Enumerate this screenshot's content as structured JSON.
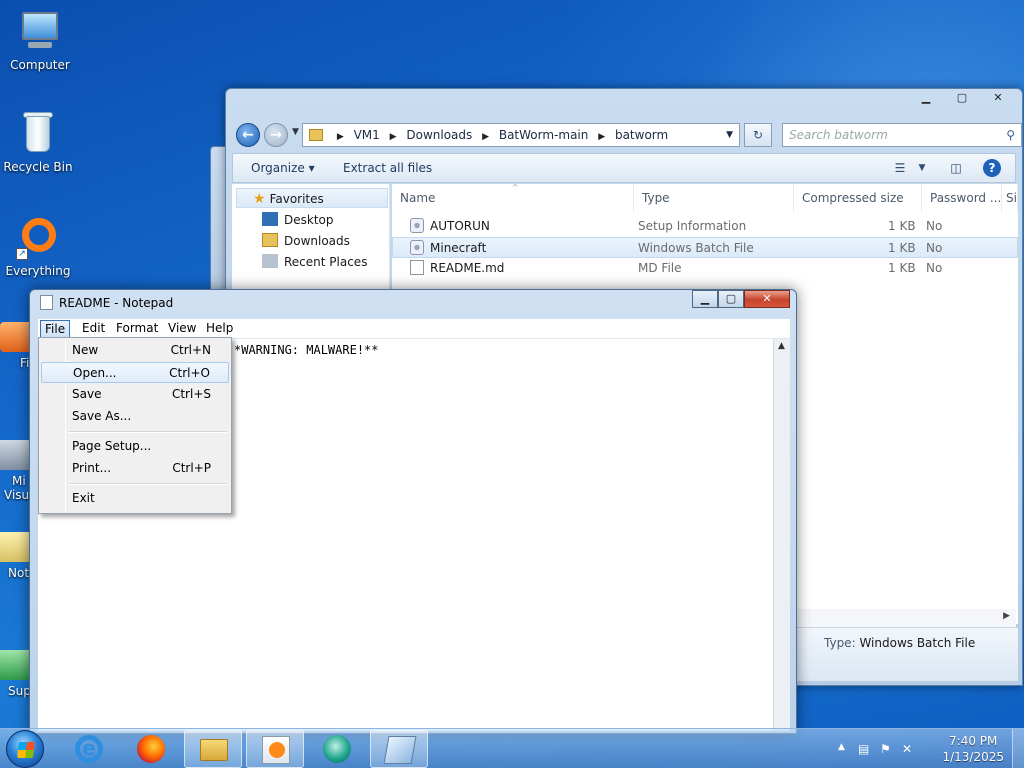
{
  "desktop": {
    "icons": [
      {
        "label": "Computer"
      },
      {
        "label": "Recycle Bin"
      },
      {
        "label": "Everything"
      }
    ],
    "partial_icons": [
      {
        "label": "Fi"
      },
      {
        "label": "Mi"
      },
      {
        "label": "Visu"
      },
      {
        "label": "Not"
      },
      {
        "label": "Sup"
      }
    ]
  },
  "explorer": {
    "address": [
      "VM1",
      "Downloads",
      "BatWorm-main",
      "batworm"
    ],
    "search_placeholder": "Search batworm",
    "toolbar": {
      "organize": "Organize ▾",
      "extract": "Extract all files"
    },
    "nav": {
      "favorites": "Favorites",
      "items": [
        "Desktop",
        "Downloads",
        "Recent Places"
      ]
    },
    "columns": [
      "Name",
      "Type",
      "Compressed size",
      "Password ...",
      "Si"
    ],
    "files": [
      {
        "name": "AUTORUN",
        "type": "Setup Information",
        "size": "1 KB",
        "password": "No"
      },
      {
        "name": "Minecraft",
        "type": "Windows Batch File",
        "size": "1 KB",
        "password": "No"
      },
      {
        "name": "README.md",
        "type": "MD File",
        "size": "1 KB",
        "password": "No"
      }
    ],
    "details": {
      "type_label": "Type:",
      "type_value": "Windows Batch File"
    }
  },
  "notepad": {
    "title": "README - Notepad",
    "menu": [
      "File",
      "Edit",
      "Format",
      "View",
      "Help"
    ],
    "text": "*WARNING: MALWARE!**",
    "file_menu": [
      {
        "label": "New",
        "shortcut": "Ctrl+N"
      },
      {
        "label": "Open...",
        "shortcut": "Ctrl+O"
      },
      {
        "label": "Save",
        "shortcut": "Ctrl+S"
      },
      {
        "label": "Save As...",
        "shortcut": ""
      },
      {
        "label": "Page Setup...",
        "shortcut": ""
      },
      {
        "label": "Print...",
        "shortcut": "Ctrl+P"
      },
      {
        "label": "Exit",
        "shortcut": ""
      }
    ]
  },
  "taskbar": {
    "clock_time": "7:40 PM",
    "clock_date": "1/13/2025"
  }
}
